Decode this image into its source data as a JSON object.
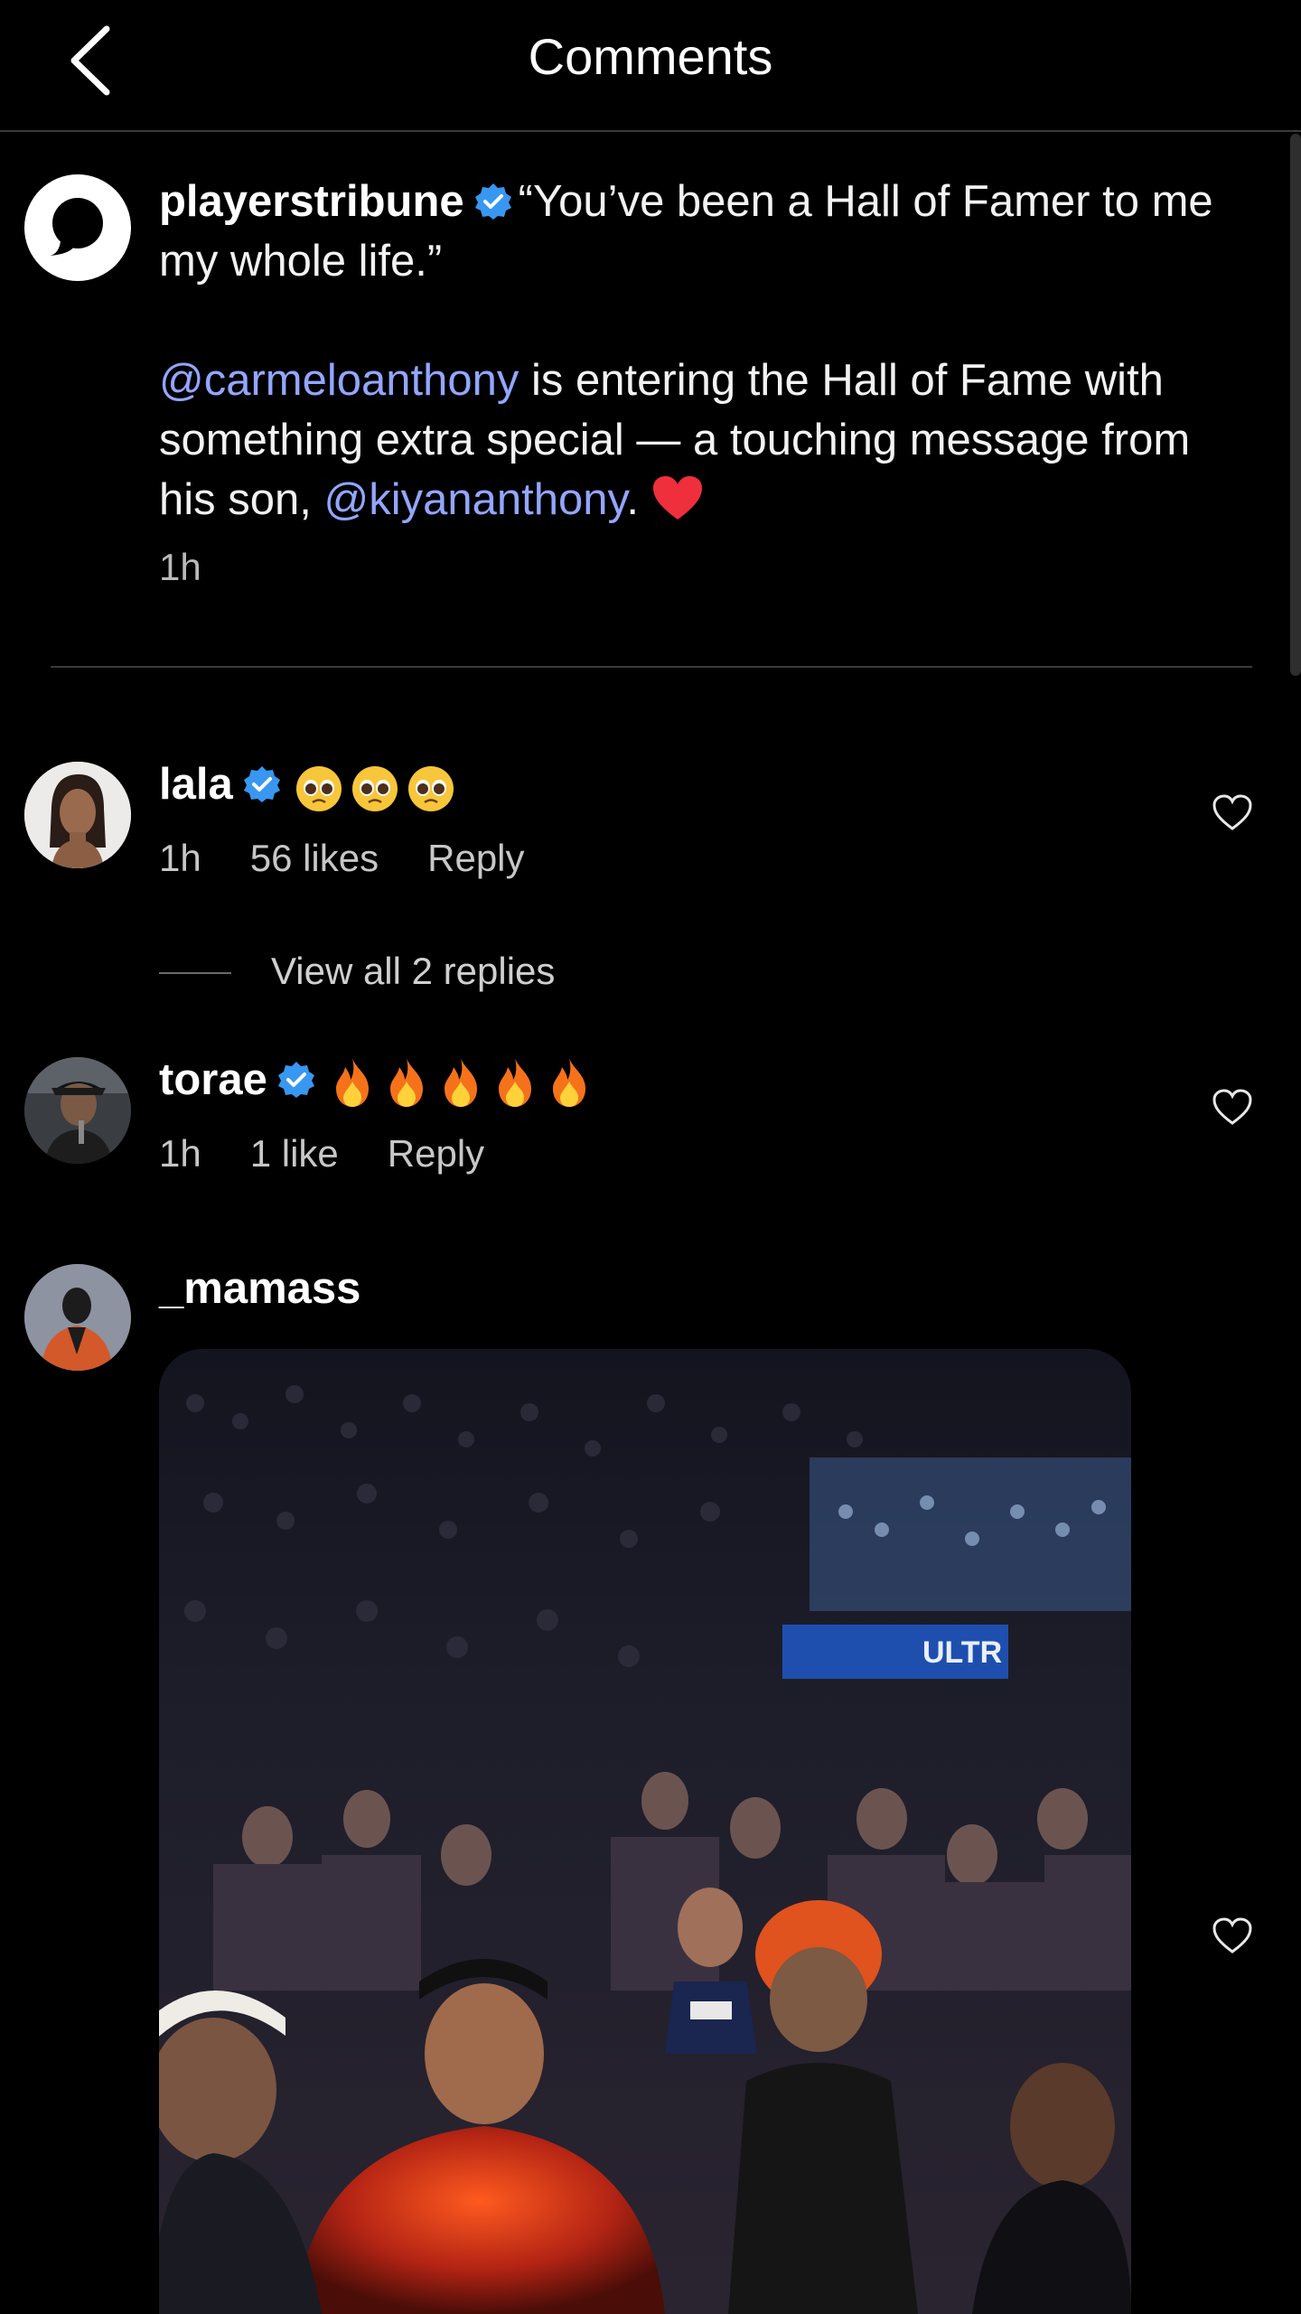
{
  "header": {
    "title": "Comments"
  },
  "post": {
    "username": "playerstribune",
    "caption_line_1": "“You’ve been a Hall of Famer to me my whole life.”",
    "mention_1": "@carmeloanthony",
    "caption_line_2": " is entering the Hall of Fame with something extra special — a touching message from his son, ",
    "mention_2": "@kiyananthony",
    "caption_end": ".",
    "time": "1h"
  },
  "comments": [
    {
      "username": "lala",
      "verified": true,
      "emoji": "pleading-face ×3",
      "time": "1h",
      "likes": "56 likes",
      "reply_label": "Reply",
      "view_replies": "View all 2 replies"
    },
    {
      "username": "torae",
      "verified": true,
      "emoji": "fire ×5",
      "time": "1h",
      "likes": "1 like",
      "reply_label": "Reply"
    },
    {
      "username": "_mamass",
      "verified": false,
      "attachment": "gif"
    }
  ],
  "gif": {
    "banner_text": "ULTR"
  },
  "colors": {
    "background": "#000000",
    "mention": "#93a6ff",
    "verified_badge": "#3897f0",
    "divider": "#3a3a3a",
    "heart_emoji": "#ef2f3b"
  }
}
